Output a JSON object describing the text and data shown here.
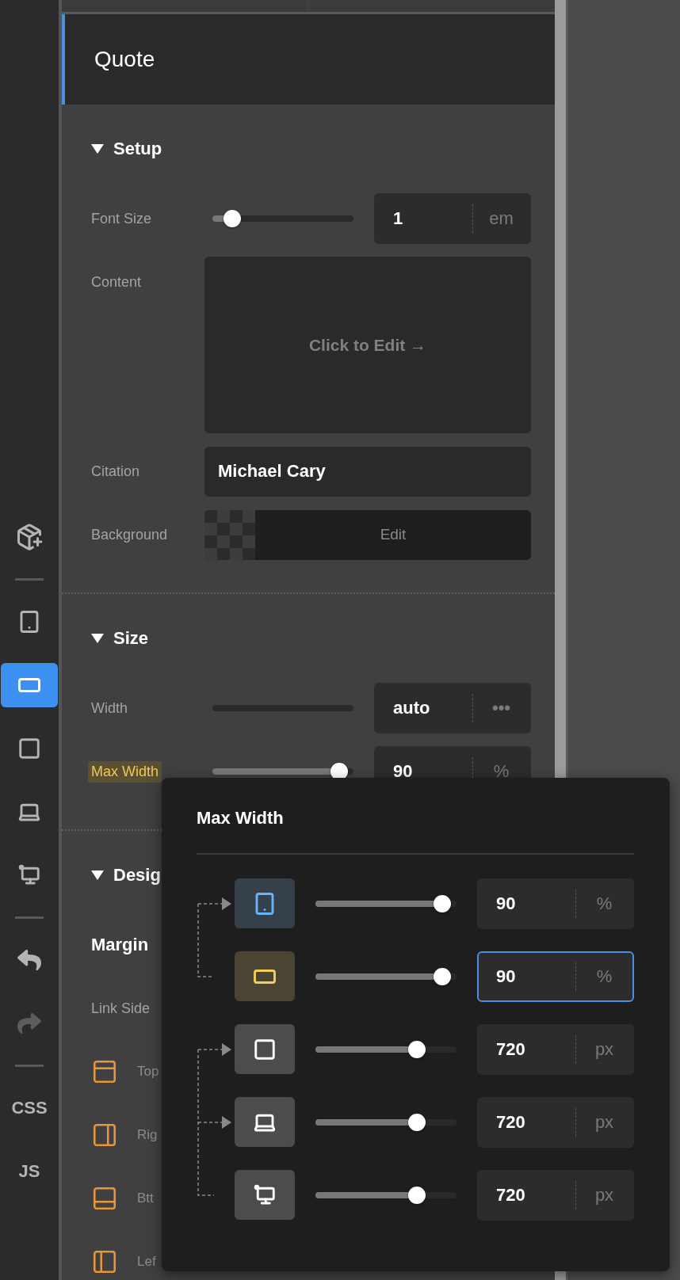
{
  "sidebar": {
    "devices": [
      {
        "selected": false
      },
      {
        "selected": true
      },
      {
        "selected": false
      },
      {
        "selected": false
      },
      {
        "selected": false
      }
    ],
    "history": [
      {
        "disabled": false
      },
      {
        "disabled": true
      }
    ],
    "code_buttons": [
      "CSS",
      "JS"
    ]
  },
  "panel": {
    "title": "Quote",
    "sections": [
      {
        "title": "Setup",
        "expanded": true,
        "rows": [
          {
            "kind": "slider",
            "label": "Font Size",
            "highlighted": false,
            "level": 0.14,
            "value": "1",
            "unit": "em"
          },
          {
            "kind": "content",
            "label": "Content",
            "action": "Click to Edit →"
          },
          {
            "kind": "text",
            "label": "Citation",
            "value": "Michael Cary"
          },
          {
            "kind": "background",
            "label": "Background",
            "action": "Edit"
          }
        ]
      },
      {
        "title": "Size",
        "expanded": true,
        "rows": [
          {
            "kind": "auto",
            "label": "Width",
            "value": "auto",
            "unit": "•••"
          },
          {
            "kind": "slider",
            "label": "Max Width",
            "highlighted": true,
            "level": 0.9,
            "value": "90",
            "unit": "%"
          }
        ]
      },
      {
        "title": "Desig",
        "expanded": true,
        "rows": [
          {
            "kind": "group",
            "label": "Margin"
          },
          {
            "kind": "plain",
            "label": "Link Side"
          },
          {
            "kind": "side",
            "label": "Top"
          },
          {
            "kind": "side",
            "label": "Rig"
          },
          {
            "kind": "side",
            "label": "Btt"
          },
          {
            "kind": "side",
            "label": "Lef"
          }
        ]
      }
    ]
  },
  "popover": {
    "title": "Max Width",
    "rows": [
      {
        "color": "#6cb4f8",
        "level": 0.9,
        "value": "90",
        "unit": "%",
        "focused": false
      },
      {
        "color": "#f5cf5a",
        "level": 0.9,
        "value": "90",
        "unit": "%",
        "focused": true
      },
      {
        "color": "#ffffff",
        "level": 0.72,
        "value": "720",
        "unit": "px",
        "focused": false
      },
      {
        "color": "#ffffff",
        "level": 0.72,
        "value": "720",
        "unit": "px",
        "focused": false
      },
      {
        "color": "#ffffff",
        "level": 0.72,
        "value": "720",
        "unit": "px",
        "focused": false
      }
    ]
  }
}
